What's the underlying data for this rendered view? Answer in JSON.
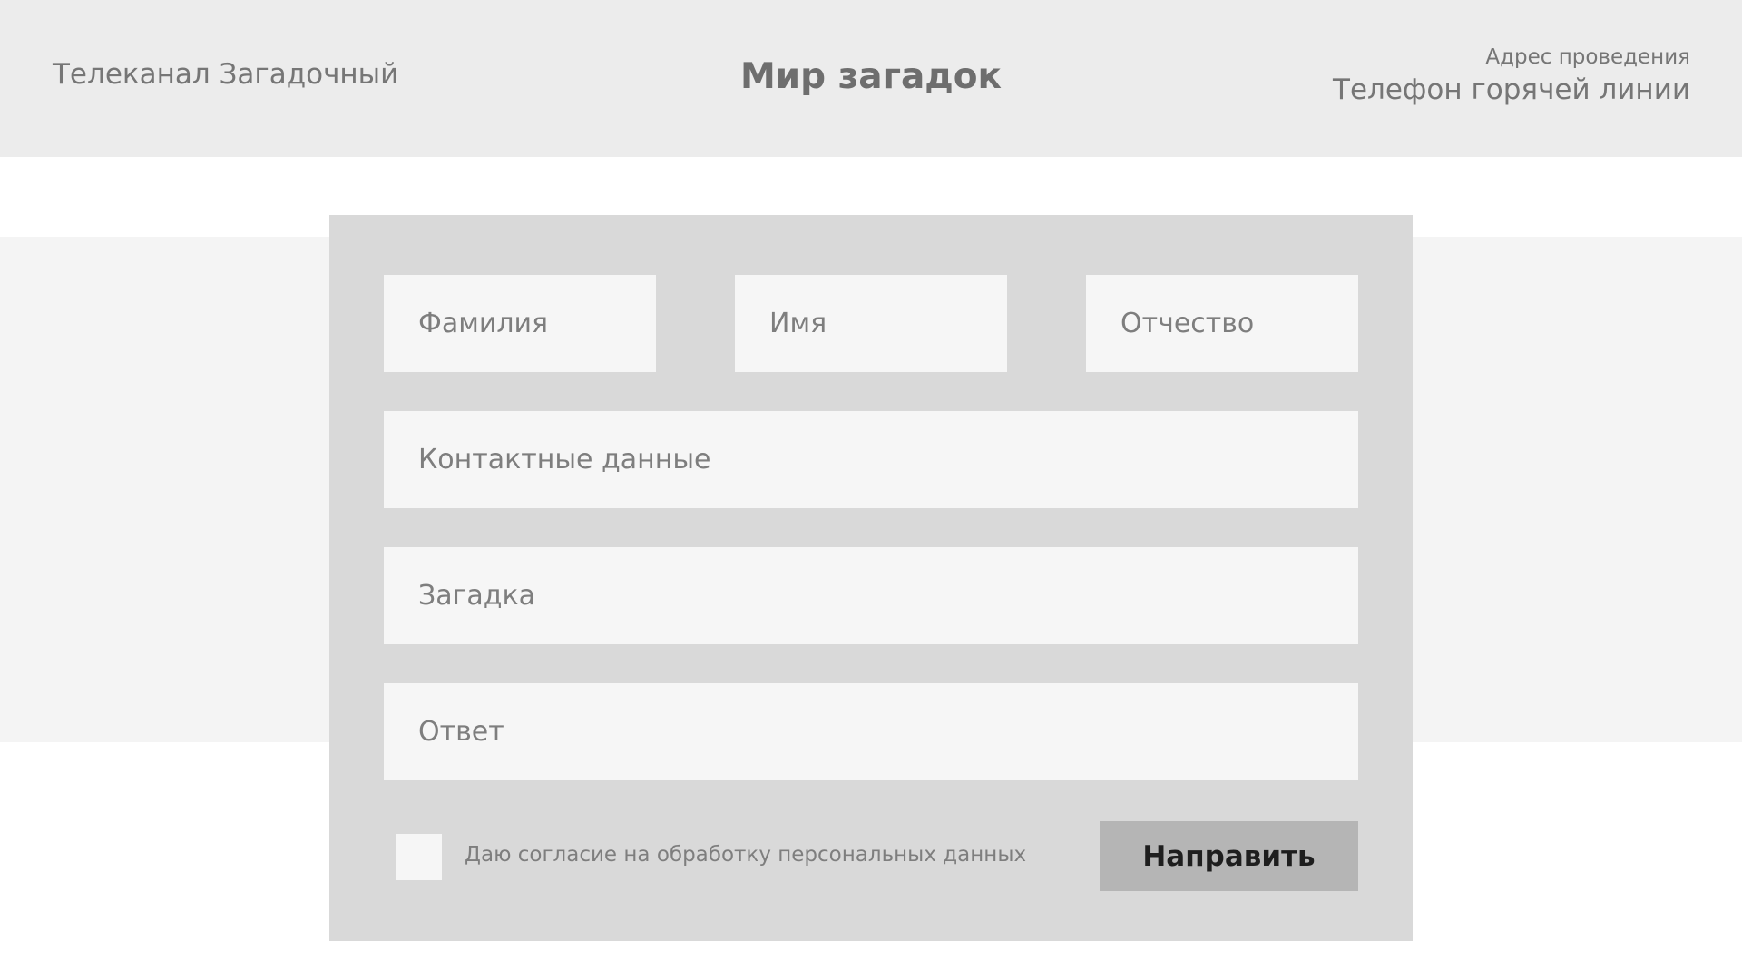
{
  "header": {
    "brand": "Телеканал Загадочный",
    "title": "Мир загадок",
    "address": "Адрес проведения",
    "hotline": "Телефон горячей линии"
  },
  "form": {
    "surname_placeholder": "Фамилия",
    "name_placeholder": "Имя",
    "patronymic_placeholder": "Отчество",
    "contact_placeholder": "Контактные данные",
    "riddle_placeholder": "Загадка",
    "answer_placeholder": "Ответ",
    "consent_label": "Даю согласие на обработку персональных данных",
    "submit_label": "Направить"
  },
  "colors": {
    "header_bg": "#ececec",
    "band_bg": "#f4f4f4",
    "card_bg": "#d9d9d9",
    "field_bg": "#f6f6f6",
    "button_bg": "#b5b5b5"
  }
}
